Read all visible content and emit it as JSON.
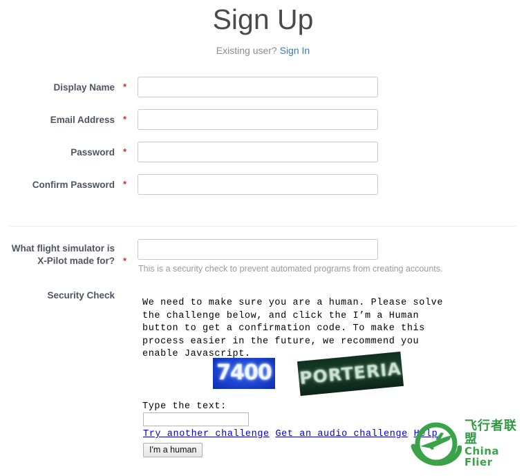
{
  "header": {
    "title": "Sign Up",
    "existing_user_text": "Existing user?",
    "sign_in_label": "Sign In"
  },
  "form": {
    "required_marker": "*",
    "fields": [
      {
        "label": "Display Name",
        "value": "",
        "placeholder": "",
        "required": true,
        "type": "text"
      },
      {
        "label": "Email Address",
        "value": "",
        "placeholder": "",
        "required": true,
        "type": "text"
      },
      {
        "label": "Password",
        "value": "",
        "placeholder": "",
        "required": true,
        "type": "password"
      },
      {
        "label": "Confirm Password",
        "value": "",
        "placeholder": "",
        "required": true,
        "type": "password"
      }
    ],
    "question": {
      "label_line1": "What flight simulator is",
      "label_line2": "X-Pilot made for?",
      "value": "",
      "placeholder": "",
      "help": "This is a security check to prevent automated programs from creating accounts."
    },
    "security_check": {
      "label": "Security Check",
      "intro": "We need to make sure you are a human. Please solve the challenge below, and click the I’m a Human button to get a confirmation code. To make this process easier in the future, we recommend you enable Javascript.",
      "images": [
        {
          "name": "captcha-image-numeric",
          "text": "7400",
          "color": "#1c44cf"
        },
        {
          "name": "captcha-image-word",
          "text": "PORTERIA",
          "color": "#17402a"
        }
      ],
      "type_label": "Type the text:",
      "answer_value": "",
      "answer_placeholder": "",
      "links": [
        {
          "label": "Try another challenge"
        },
        {
          "label": "Get an audio challenge"
        },
        {
          "label": "Help"
        }
      ],
      "submit_label": "I'm a human"
    }
  },
  "watermark": {
    "cn_text": "飞行者联盟",
    "en_text": "China Flier",
    "color": "#3aa34a"
  },
  "colors": {
    "link": "#337ab7",
    "required": "#c9302c",
    "label": "#4c5561",
    "muted": "#9a9a9a",
    "captcha_link": "#0000cc"
  }
}
